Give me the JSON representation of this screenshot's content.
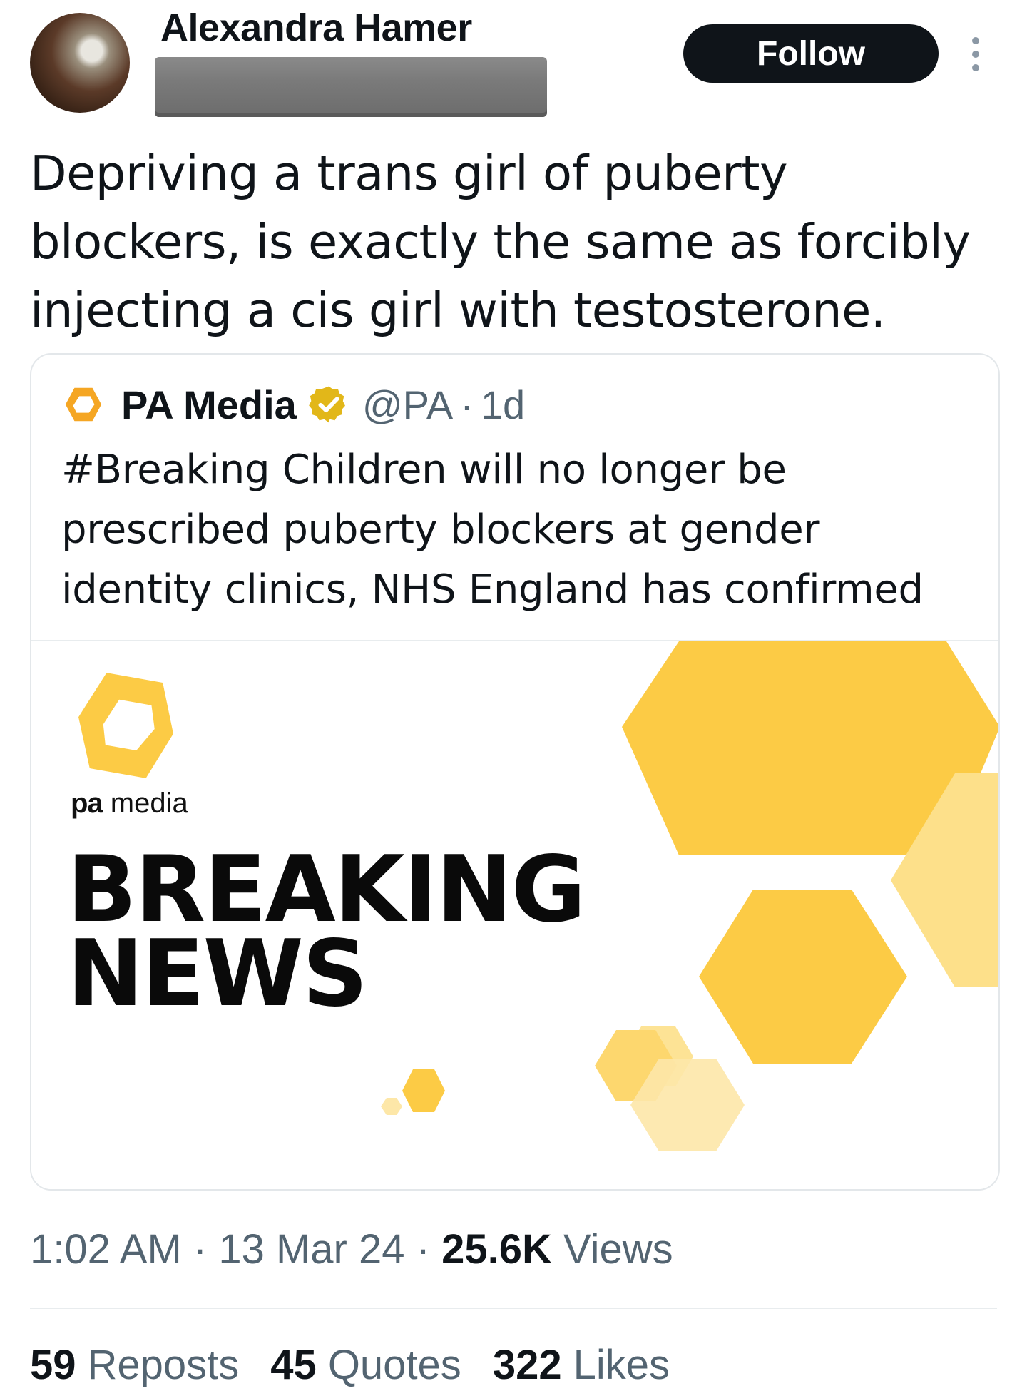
{
  "author": {
    "name": "Alexandra Hamer"
  },
  "follow_label": "Follow",
  "tweet": {
    "text_lines": [
      "Depriving a trans girl of puberty",
      "blockers, is exactly the same as forcibly",
      "injecting a cis girl with testosterone."
    ]
  },
  "quote": {
    "name": "PA Media",
    "handle": "@PA",
    "dot": "·",
    "time": "1d",
    "text_lines": [
      "#Breaking Children will no longer be",
      "prescribed puberty blockers at gender",
      "identity clinics, NHS England has confirmed"
    ],
    "media": {
      "brand_bold": "pa",
      "brand_light": " media",
      "headline_line1": "BREAKING",
      "headline_line2": "NEWS"
    }
  },
  "meta": {
    "time": "1:02 AM",
    "sep": " · ",
    "date": "13 Mar 24",
    "views_count": "25.6K",
    "views_label": " Views"
  },
  "stats": [
    {
      "count": "59",
      "label": "Reposts"
    },
    {
      "count": "45",
      "label": "Quotes"
    },
    {
      "count": "322",
      "label": "Likes"
    }
  ],
  "colors": {
    "accent_yellow": "#fccb45",
    "pa_orange": "#f5a623",
    "verified_gold": "#e2b719"
  }
}
